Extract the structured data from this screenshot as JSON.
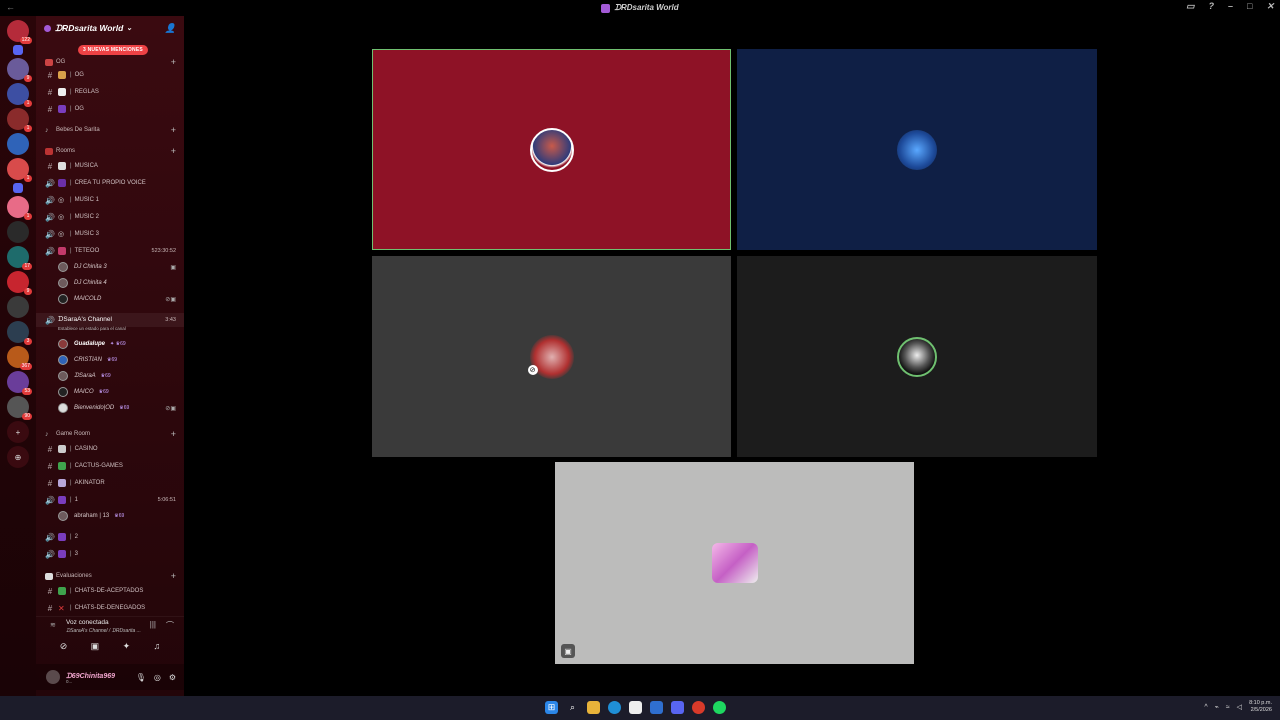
{
  "window": {
    "title": "ᗪRDsarita World"
  },
  "servers": [
    {
      "badge": "122",
      "color": "#b52b3a"
    },
    {
      "badge": "",
      "color": "#5865f2",
      "small": true
    },
    {
      "badge": "9",
      "color": "#6a5b9a"
    },
    {
      "badge": "1",
      "color": "#3d4fa3"
    },
    {
      "badge": "1",
      "color": "#8a2b2b"
    },
    {
      "badge": "",
      "color": "#2f63b8"
    },
    {
      "badge": "1",
      "color": "#d84b4b"
    },
    {
      "badge": "",
      "color": "#5865f2",
      "small": true
    },
    {
      "badge": "1",
      "color": "#e86b87"
    },
    {
      "badge": "",
      "color": "#2a2a2a"
    },
    {
      "badge": "17",
      "color": "#1e6b6b"
    },
    {
      "badge": "9",
      "color": "#c7252f"
    },
    {
      "badge": "",
      "color": "#3a3a3a"
    },
    {
      "badge": "3",
      "color": "#2c3e50"
    },
    {
      "badge": "367",
      "color": "#b85a1a"
    },
    {
      "badge": "53",
      "color": "#6a3d9a"
    },
    {
      "badge": "90",
      "color": "#555"
    }
  ],
  "sidebar": {
    "guild_name": "ᗪRDsarita World",
    "mentions_banner": "3 NUEVAS MENCIONES",
    "channels": {
      "og_cat": "OG",
      "og1": "OG",
      "reglas": "REGLAS",
      "og2": "OG",
      "bebes_cat": "Bebes De Sarita",
      "rooms_cat": "Rooms",
      "musica": "MUSICA",
      "crea": "CREA TU PROPIO VOICE",
      "music1": "MUSIC 1",
      "music2": "MUSIC 2",
      "music3": "MUSIC 3",
      "tereo": "TETEOO",
      "tereo_time": "523:30:52",
      "dj1": "DJ Chinita 3",
      "dj2": "DJ Chinita 4",
      "maicol": "MAICOLD",
      "sara_channel": "ᗪSaraA's Channel",
      "sara_time": "3:43",
      "sara_sub": "Establece un estado para el canal",
      "guadalupe": "Guadalupe",
      "cristian": "CRISTIAN",
      "sarau": "ᗪSaraA",
      "maico": "MAICO",
      "bienvenido": "Bienvenido|OD",
      "game_cat": "Game Room",
      "casino": "CASINO",
      "cactus": "CACTUS-GAMES",
      "akinator": "AKINATOR",
      "v1": "1",
      "v1_time": "5:06:51",
      "abraham": "abraham | 13",
      "v2": "2",
      "v3": "3",
      "eval_cat": "Evaluaciones",
      "aceptados": "CHATS-DE-ACEPTADOS",
      "denegados": "CHATS-DE-DENEGADOS"
    },
    "voice": {
      "status": "Voz conectada",
      "channel": "ᗪSaraA's Channel / ᗪRDsarita ..."
    },
    "user": {
      "name": "ᗪ69Chinita969",
      "status": "0..."
    }
  },
  "stage": {
    "tiles": [
      {
        "name": "tile-1",
        "bg": "#8e1226"
      },
      {
        "name": "tile-2",
        "bg": "#0f1f45"
      },
      {
        "name": "tile-3",
        "bg": "#3a3a3a"
      },
      {
        "name": "tile-4",
        "bg": "#1c1c1c"
      },
      {
        "name": "tile-5",
        "bg": "#bcbcbb"
      }
    ]
  },
  "taskbar": {
    "time": "8:10 p.m.",
    "date": "2/5/2026"
  }
}
